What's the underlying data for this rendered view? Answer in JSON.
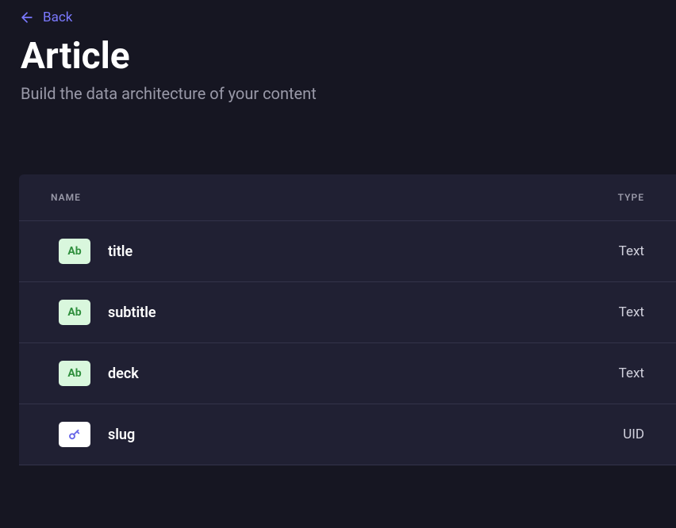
{
  "back": {
    "label": "Back"
  },
  "header": {
    "title": "Article",
    "subtitle": "Build the data architecture of your content"
  },
  "table": {
    "headers": {
      "name": "NAME",
      "type": "TYPE"
    },
    "rows": [
      {
        "icon_variant": "text",
        "icon_label": "Ab",
        "name": "title",
        "type": "Text"
      },
      {
        "icon_variant": "text",
        "icon_label": "Ab",
        "name": "subtitle",
        "type": "Text"
      },
      {
        "icon_variant": "text",
        "icon_label": "Ab",
        "name": "deck",
        "type": "Text"
      },
      {
        "icon_variant": "uid",
        "icon_label": "key",
        "name": "slug",
        "type": "UID"
      }
    ]
  }
}
